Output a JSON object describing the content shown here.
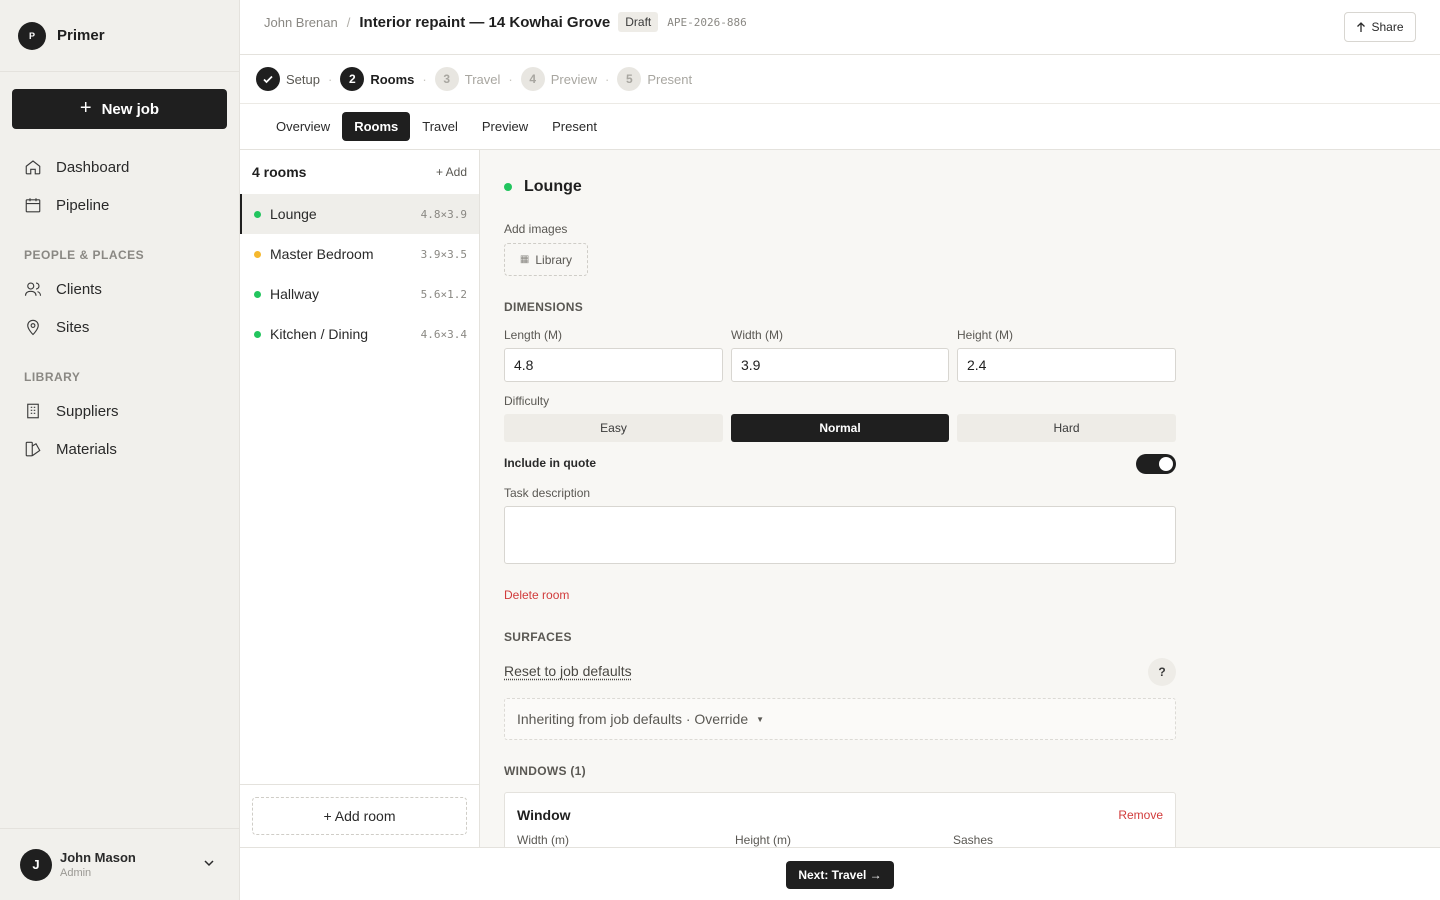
{
  "brand": {
    "logo_letter": "P",
    "name": "Primer"
  },
  "sidebar": {
    "new_job_label": "New job",
    "main_items": [
      {
        "label": "Dashboard",
        "icon": "home-icon"
      },
      {
        "label": "Pipeline",
        "icon": "calendar-icon"
      }
    ],
    "section_people": "PEOPLE & PLACES",
    "people_items": [
      {
        "label": "Clients",
        "icon": "users-icon"
      },
      {
        "label": "Sites",
        "icon": "map-pin-icon"
      }
    ],
    "section_library": "LIBRARY",
    "library_items": [
      {
        "label": "Suppliers",
        "icon": "building-icon"
      },
      {
        "label": "Materials",
        "icon": "swatch-icon"
      }
    ],
    "user": {
      "initial": "J",
      "name": "John Mason",
      "role": "Admin"
    }
  },
  "header": {
    "client": "John Brenan",
    "separator": "/",
    "job_title": "Interior repaint — 14 Kowhai Grove",
    "status_badge": "Draft",
    "job_ref": "APE-2026-886",
    "share_label": "Share"
  },
  "stepper": {
    "steps": [
      {
        "num": "1",
        "label": "Setup",
        "state": "done"
      },
      {
        "num": "2",
        "label": "Rooms",
        "state": "active"
      },
      {
        "num": "3",
        "label": "Travel",
        "state": "pending"
      },
      {
        "num": "4",
        "label": "Preview",
        "state": "pending"
      },
      {
        "num": "5",
        "label": "Present",
        "state": "pending"
      }
    ],
    "separator": "·"
  },
  "tabs": [
    {
      "label": "Overview",
      "active": false
    },
    {
      "label": "Rooms",
      "active": true
    },
    {
      "label": "Travel",
      "active": false
    },
    {
      "label": "Preview",
      "active": false
    },
    {
      "label": "Present",
      "active": false
    }
  ],
  "rooms_panel": {
    "count_label": "4 rooms",
    "add_label": "+ Add",
    "rooms": [
      {
        "name": "Lounge",
        "dims": "4.8×3.9",
        "status_color": "#22c55e",
        "selected": true
      },
      {
        "name": "Master Bedroom",
        "dims": "3.9×3.5",
        "status_color": "#f5b82e",
        "selected": false
      },
      {
        "name": "Hallway",
        "dims": "5.6×1.2",
        "status_color": "#22c55e",
        "selected": false
      },
      {
        "name": "Kitchen / Dining",
        "dims": "4.6×3.4",
        "status_color": "#22c55e",
        "selected": false
      }
    ],
    "add_room_label": "+ Add room"
  },
  "detail": {
    "room_name": "Lounge",
    "room_status_color": "#22c55e",
    "add_images_label": "Add images",
    "library_label": "Library",
    "dimensions_label": "DIMENSIONS",
    "length_label": "Length (M)",
    "length_value": "4.8",
    "width_label": "Width (M)",
    "width_value": "3.9",
    "height_label": "Height (M)",
    "height_value": "2.4",
    "difficulty_label": "Difficulty",
    "difficulty_options": [
      "Easy",
      "Normal",
      "Hard"
    ],
    "difficulty_selected": "Normal",
    "include_label": "Include in quote",
    "include_on": true,
    "task_label": "Task description",
    "task_value": "",
    "delete_label": "Delete room",
    "surfaces_label": "SURFACES",
    "reset_label": "Reset to job defaults",
    "help_label": "?",
    "inherit_label": "Inheriting from job defaults · Override",
    "windows_label": "WINDOWS (1)",
    "window": {
      "title": "Window",
      "remove_label": "Remove",
      "width_label": "Width (m)",
      "height_label": "Height (m)",
      "sashes_label": "Sashes"
    }
  },
  "footer": {
    "next_label": "Next: Travel →"
  },
  "colors": {
    "accent": "#1f1f1f",
    "danger": "#d13b3b",
    "ok": "#22c55e",
    "warn": "#f5b82e"
  }
}
